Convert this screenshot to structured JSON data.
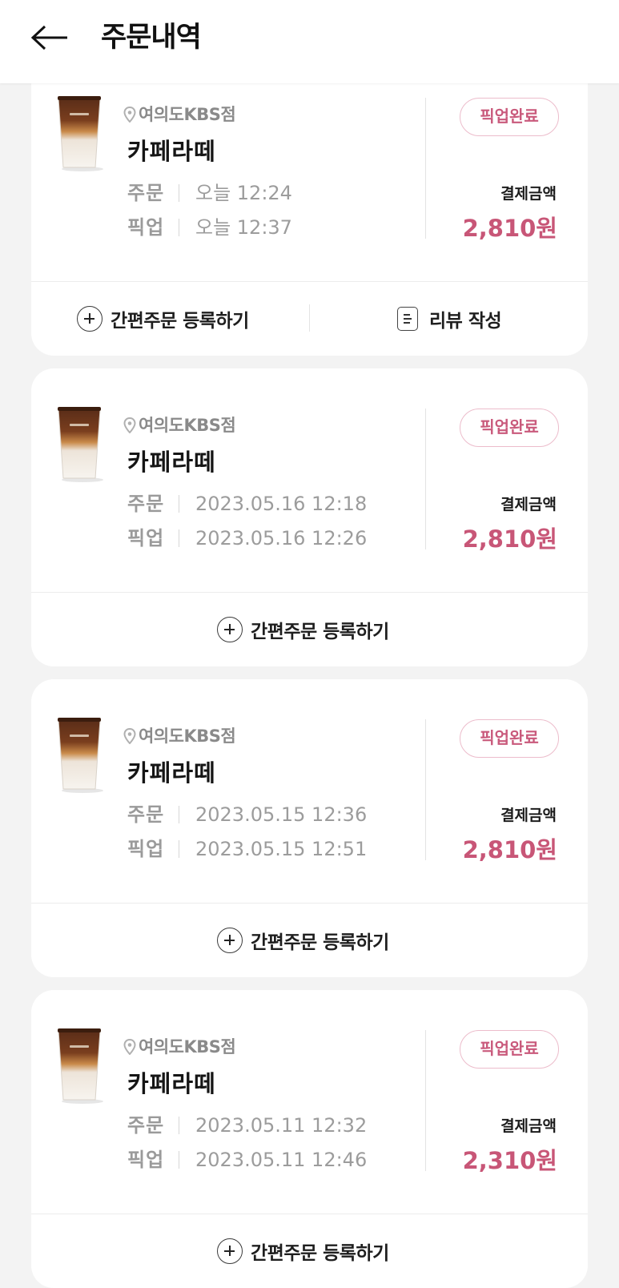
{
  "header": {
    "title": "주문내역",
    "back_icon": "back-arrow-icon"
  },
  "colors": {
    "accent": "#c85677",
    "badge_border": "#ecbccb",
    "background": "#f3f3f3"
  },
  "orders": [
    {
      "store": "여의도KBS점",
      "product": "카페라떼",
      "order_label": "주문",
      "order_time": "오늘 12:24",
      "pickup_label": "픽업",
      "pickup_time": "오늘 12:37",
      "status": "픽업완료",
      "pay_label": "결제금액",
      "amount": "2,810원",
      "actions": {
        "quick_order": "간편주문 등록하기",
        "review": "리뷰 작성"
      }
    },
    {
      "store": "여의도KBS점",
      "product": "카페라떼",
      "order_label": "주문",
      "order_time": "2023.05.16 12:18",
      "pickup_label": "픽업",
      "pickup_time": "2023.05.16 12:26",
      "status": "픽업완료",
      "pay_label": "결제금액",
      "amount": "2,810원",
      "actions": {
        "quick_order": "간편주문 등록하기"
      }
    },
    {
      "store": "여의도KBS점",
      "product": "카페라떼",
      "order_label": "주문",
      "order_time": "2023.05.15 12:36",
      "pickup_label": "픽업",
      "pickup_time": "2023.05.15 12:51",
      "status": "픽업완료",
      "pay_label": "결제금액",
      "amount": "2,810원",
      "actions": {
        "quick_order": "간편주문 등록하기"
      }
    },
    {
      "store": "여의도KBS점",
      "product": "카페라떼",
      "order_label": "주문",
      "order_time": "2023.05.11 12:32",
      "pickup_label": "픽업",
      "pickup_time": "2023.05.11 12:46",
      "status": "픽업완료",
      "pay_label": "결제금액",
      "amount": "2,310원",
      "actions": {
        "quick_order": "간편주문 등록하기"
      }
    }
  ]
}
